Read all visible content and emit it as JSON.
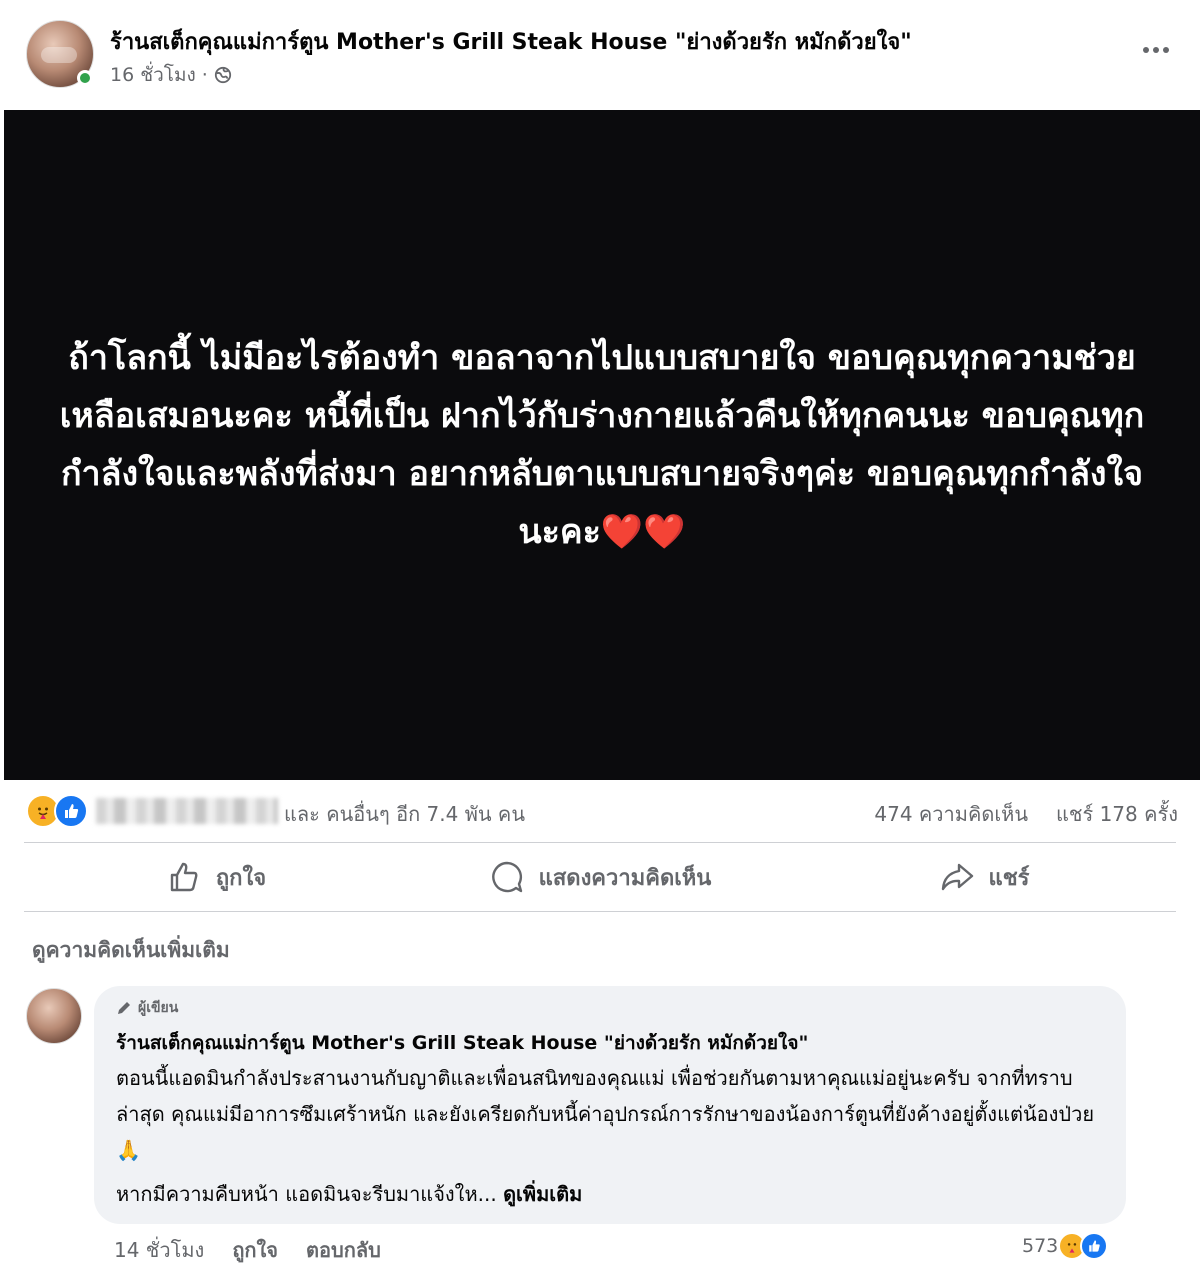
{
  "post": {
    "page_name": "ร้านสเต็กคุณแม่การ์ตูน Mother's Grill Steak House \"ย่างด้วยรัก หมักด้วยใจ\"",
    "time": "16 ชั่วโมง",
    "separator": "·",
    "privacy_icon": "globe-icon",
    "image_text": "ถ้าโลกนี้ ไม่มีอะไรต้องทำ ขอลาจากไปแบบสบายใจ ขอบคุณทุกความช่วยเหลือเสมอนะคะ หนี้ที่เป็น ฝากไว้กับร่างกายแล้วคืนให้ทุกคนนะ ขอบคุณทุกกำลังใจและพลังที่ส่งมา อยากหลับตาแบบสบายจริงๆค่ะ ขอบคุณทุกกำลังใจนะคะ",
    "image_hearts": "❤️❤️"
  },
  "stats": {
    "others": "และ คนอื่นๆ อีก 7.4 พัน คน",
    "comments": "474 ความคิดเห็น",
    "shares": "แชร์ 178 ครั้ง"
  },
  "actions": {
    "like": "ถูกใจ",
    "comment": "แสดงความคิดเห็น",
    "share": "แชร์"
  },
  "more_comments": "ดูความคิดเห็นเพิ่มเติม",
  "comment": {
    "badge": "ผู้เขียน",
    "author": "ร้านสเต็กคุณแม่การ์ตูน Mother's Grill Steak House \"ย่างด้วยรัก หมักด้วยใจ\"",
    "body": "ตอนนี้แอดมินกำลังประสานงานกับญาติและเพื่อนสนิทของคุณแม่ เพื่อช่วยกันตามหาคุณแม่อยู่นะครับ จากที่ทราบล่าสุด คุณแม่มีอาการซึมเศร้าหนัก และยังเครียดกับหนี้ค่าอุปกรณ์การรักษาของน้องการ์ตูนที่ยังค้างอยู่ตั้งแต่น้องป่วย🙏",
    "last_line": "หากมีความคืบหน้า แอดมินจะรีบมาแจ้งให...",
    "see_more": "ดูเพิ่มเติม",
    "time": "14 ชั่วโมง",
    "like": "ถูกใจ",
    "reply": "ตอบกลับ",
    "reaction_count": "573"
  },
  "colors": {
    "like_blue": "#1877f2",
    "care_yellow": "#f7b125",
    "online_green": "#31a24c",
    "secondary_text": "#65676b"
  }
}
